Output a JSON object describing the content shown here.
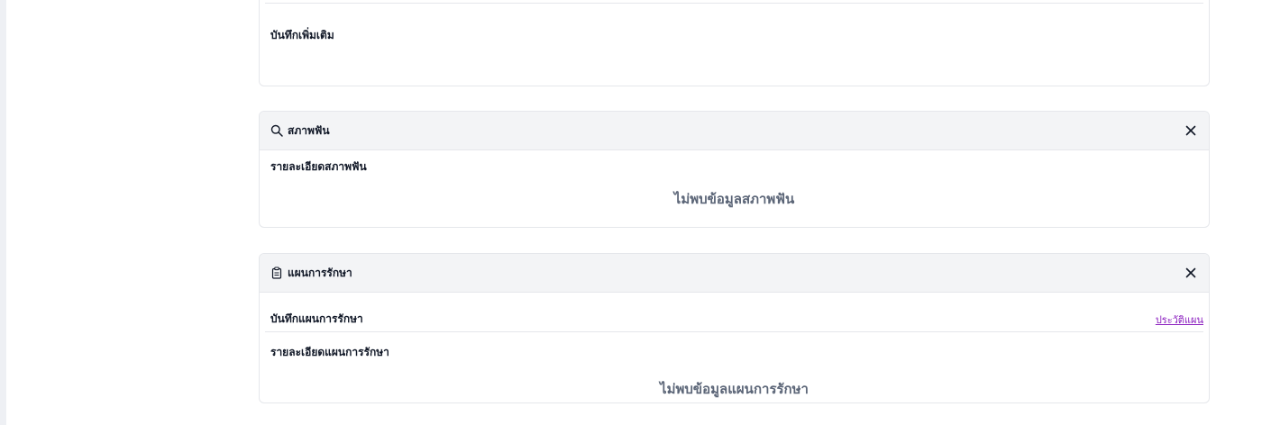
{
  "notes_card": {
    "label": "บันทึกเพิ่มเติม"
  },
  "teeth_card": {
    "title": "สภาพฟัน",
    "header_icon": "search-icon",
    "close_icon": "close-icon",
    "detail_label": "รายละเอียดสภาพฟัน",
    "empty_message": "ไม่พบข้อมูลสภาพฟัน"
  },
  "plan_card": {
    "title": "แผนการรักษา",
    "header_icon": "clipboard-icon",
    "close_icon": "close-icon",
    "record_label": "บันทึกแผนการรักษา",
    "history_link": "ประวัติแผน",
    "detail_label": "รายละเอียดแผนการรักษา",
    "empty_message": "ไม่พบข้อมูลแผนการรักษา"
  },
  "colors": {
    "header_bg": "#f3f4f6",
    "border": "#e5e7eb",
    "link": "#8b1fbf",
    "empty_text": "#5b6577"
  }
}
